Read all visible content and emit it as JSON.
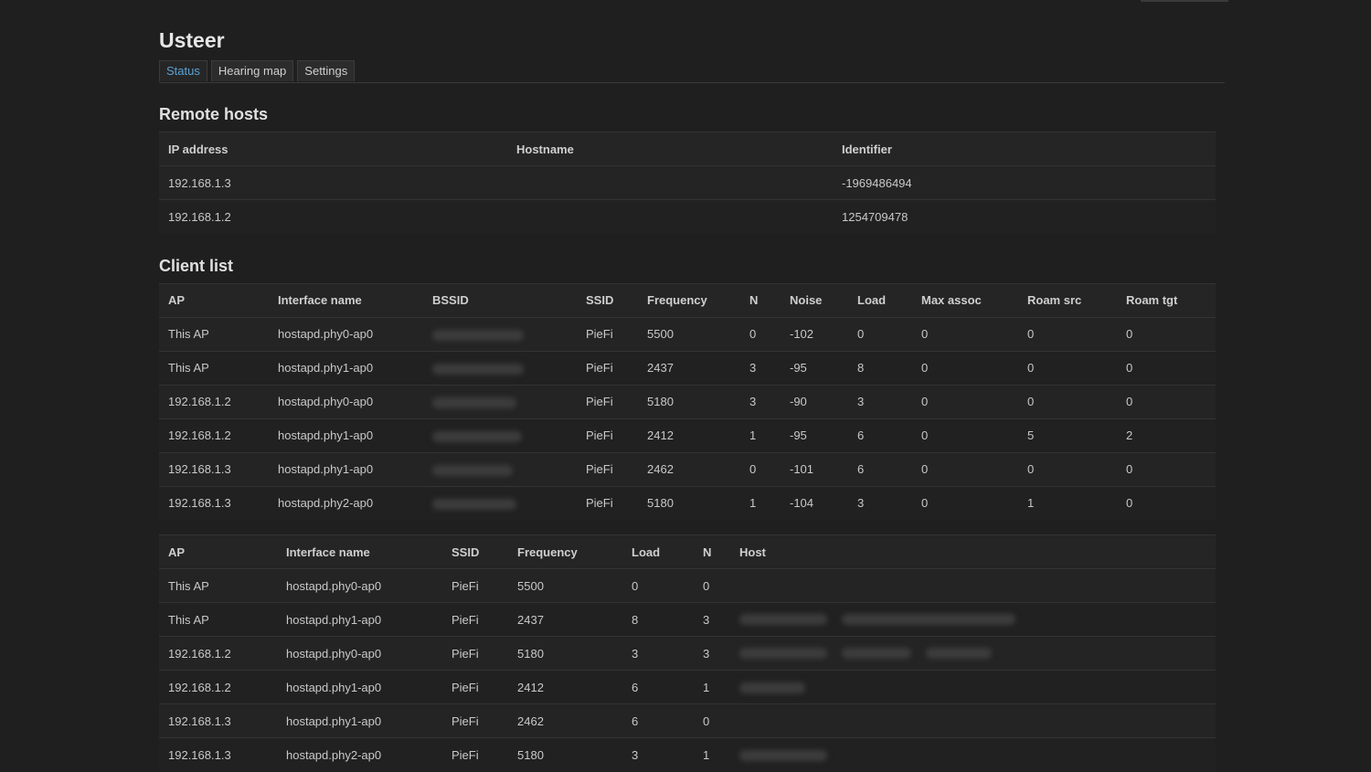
{
  "app": {
    "title": "Usteer"
  },
  "tabs": [
    {
      "label": "Status"
    },
    {
      "label": "Hearing map"
    },
    {
      "label": "Settings"
    }
  ],
  "remote_hosts": {
    "heading": "Remote hosts",
    "columns": [
      "IP address",
      "Hostname",
      "Identifier"
    ],
    "rows": [
      {
        "ip": "192.168.1.3",
        "hostname": "",
        "identifier": "-1969486494"
      },
      {
        "ip": "192.168.1.2",
        "hostname": "",
        "identifier": "1254709478"
      }
    ]
  },
  "client_list": {
    "heading": "Client list",
    "columns": [
      "AP",
      "Interface name",
      "BSSID",
      "SSID",
      "Frequency",
      "N",
      "Noise",
      "Load",
      "Max assoc",
      "Roam src",
      "Roam tgt"
    ],
    "rows": [
      {
        "ap": "This AP",
        "iface": "hostapd.phy0-ap0",
        "ssid": "PieFi",
        "freq": "5500",
        "n": "0",
        "noise": "-102",
        "load": "0",
        "max_assoc": "0",
        "roam_src": "0",
        "roam_tgt": "0"
      },
      {
        "ap": "This AP",
        "iface": "hostapd.phy1-ap0",
        "ssid": "PieFi",
        "freq": "2437",
        "n": "3",
        "noise": "-95",
        "load": "8",
        "max_assoc": "0",
        "roam_src": "0",
        "roam_tgt": "0"
      },
      {
        "ap": "192.168.1.2",
        "iface": "hostapd.phy0-ap0",
        "ssid": "PieFi",
        "freq": "5180",
        "n": "3",
        "noise": "-90",
        "load": "3",
        "max_assoc": "0",
        "roam_src": "0",
        "roam_tgt": "0"
      },
      {
        "ap": "192.168.1.2",
        "iface": "hostapd.phy1-ap0",
        "ssid": "PieFi",
        "freq": "2412",
        "n": "1",
        "noise": "-95",
        "load": "6",
        "max_assoc": "0",
        "roam_src": "5",
        "roam_tgt": "2"
      },
      {
        "ap": "192.168.1.3",
        "iface": "hostapd.phy1-ap0",
        "ssid": "PieFi",
        "freq": "2462",
        "n": "0",
        "noise": "-101",
        "load": "6",
        "max_assoc": "0",
        "roam_src": "0",
        "roam_tgt": "0"
      },
      {
        "ap": "192.168.1.3",
        "iface": "hostapd.phy2-ap0",
        "ssid": "PieFi",
        "freq": "5180",
        "n": "1",
        "noise": "-104",
        "load": "3",
        "max_assoc": "0",
        "roam_src": "1",
        "roam_tgt": "0"
      }
    ]
  },
  "host_list": {
    "columns": [
      "AP",
      "Interface name",
      "SSID",
      "Frequency",
      "Load",
      "N",
      "Host"
    ],
    "rows": [
      {
        "ap": "This AP",
        "iface": "hostapd.phy0-ap0",
        "ssid": "PieFi",
        "freq": "5500",
        "load": "0",
        "n": "0"
      },
      {
        "ap": "This AP",
        "iface": "hostapd.phy1-ap0",
        "ssid": "PieFi",
        "freq": "2437",
        "load": "8",
        "n": "3"
      },
      {
        "ap": "192.168.1.2",
        "iface": "hostapd.phy0-ap0",
        "ssid": "PieFi",
        "freq": "5180",
        "load": "3",
        "n": "3"
      },
      {
        "ap": "192.168.1.2",
        "iface": "hostapd.phy1-ap0",
        "ssid": "PieFi",
        "freq": "2412",
        "load": "6",
        "n": "1"
      },
      {
        "ap": "192.168.1.3",
        "iface": "hostapd.phy1-ap0",
        "ssid": "PieFi",
        "freq": "2462",
        "load": "6",
        "n": "0"
      },
      {
        "ap": "192.168.1.3",
        "iface": "hostapd.phy2-ap0",
        "ssid": "PieFi",
        "freq": "5180",
        "load": "3",
        "n": "1"
      }
    ]
  }
}
